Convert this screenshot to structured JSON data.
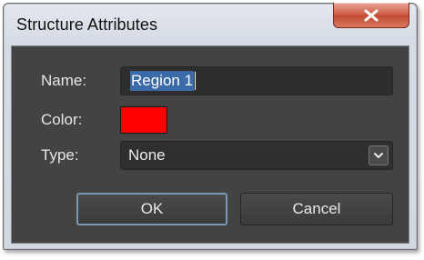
{
  "window": {
    "title": "Structure Attributes"
  },
  "form": {
    "name_label": "Name:",
    "name_value": "Region 1",
    "color_label": "Color:",
    "color_value": "#ff0000",
    "type_label": "Type:",
    "type_value": "None"
  },
  "buttons": {
    "ok_label": "OK",
    "cancel_label": "Cancel"
  },
  "icons": {
    "close": "close-x-icon",
    "dropdown": "chevron-down-icon"
  },
  "colors": {
    "client_bg": "#434343",
    "close_button": "#c24a33",
    "selection": "#3b6aa8"
  }
}
